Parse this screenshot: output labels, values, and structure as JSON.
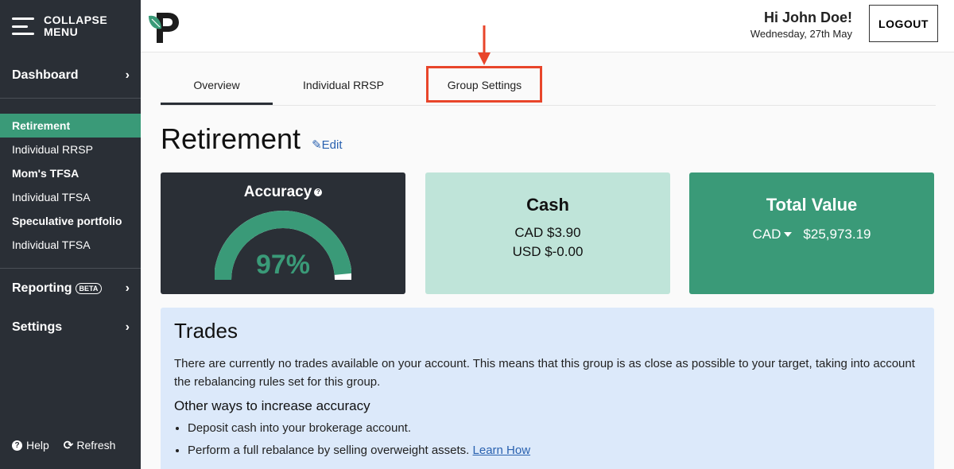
{
  "sidebar": {
    "collapse_label_1": "COLLAPSE",
    "collapse_label_2": "MENU",
    "dashboard": "Dashboard",
    "groups": [
      {
        "name": "Retirement",
        "account": "Individual RRSP"
      },
      {
        "name": "Mom's TFSA",
        "account": "Individual TFSA"
      },
      {
        "name": "Speculative portfolio",
        "account": "Individual TFSA"
      }
    ],
    "reporting": "Reporting",
    "beta": "BETA",
    "settings": "Settings",
    "help": "Help",
    "refresh": "Refresh"
  },
  "header": {
    "greeting": "Hi John Doe!",
    "date": "Wednesday, 27th May",
    "logout": "LOGOUT"
  },
  "tabs": [
    {
      "label": "Overview"
    },
    {
      "label": "Individual RRSP"
    },
    {
      "label": "Group Settings"
    }
  ],
  "page": {
    "title": "Retirement",
    "edit": "Edit"
  },
  "accuracy": {
    "title": "Accuracy",
    "value": "97%",
    "fraction": 0.97
  },
  "cash": {
    "title": "Cash",
    "cad": "CAD $3.90",
    "usd": "USD $-0.00"
  },
  "total": {
    "title": "Total Value",
    "currency": "CAD",
    "value": "$25,973.19"
  },
  "trades": {
    "title": "Trades",
    "message": "There are currently no trades available on your account. This means that this group is as close as possible to your target, taking into account the rebalancing rules set for this group.",
    "subtitle": "Other ways to increase accuracy",
    "item1": "Deposit cash into your brokerage account.",
    "item2": "Perform a full rebalance by selling overweight assets.",
    "learn_link": "Learn How"
  },
  "colors": {
    "sidebar_bg": "#2a2f36",
    "accent_green": "#3a9a78",
    "highlight_red": "#e8452a",
    "link_blue": "#2a62b0"
  }
}
